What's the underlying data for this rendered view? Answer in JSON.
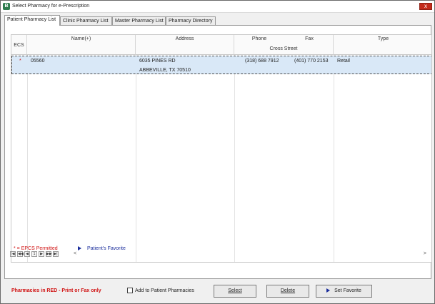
{
  "window": {
    "title": "Select Pharmacy for e-Prescription",
    "app_icon_letter": "B",
    "close_glyph": "x"
  },
  "tabs": [
    {
      "label": "Patient Pharmacy List"
    },
    {
      "label": "Clinic Pharmacy List"
    },
    {
      "label": "Master Pharmacy List"
    },
    {
      "label": "Pharmacy Directory"
    }
  ],
  "grid": {
    "columns": {
      "ecs": "ECS",
      "name": "Name(+)",
      "address": "Address",
      "phone": "Phone",
      "fax": "Fax",
      "cross_street": "Cross Street",
      "type": "Type"
    },
    "rows": [
      {
        "ecs": "*",
        "name": "05560",
        "address_line1": "6035 PINES RD",
        "address_line2": "ABBEVILLE, TX 70510",
        "phone": "(318) 688 7912",
        "fax": "(401) 770 2153",
        "type": "Retail"
      }
    ]
  },
  "navigator": {
    "first": "|◀",
    "prev_page": "◀◀",
    "prev": "◀",
    "page": "1",
    "next": "▶",
    "next_page": "▶▶",
    "last": "▶|",
    "scroll_left": "<",
    "scroll_right": ">"
  },
  "legend": {
    "epcs": "* = EPCS Permitted",
    "favorite": "Patient's Favorite"
  },
  "footer": {
    "note": "Pharmacies in RED - Print or Fax only",
    "add_checkbox_label": "Add to Patient Pharmacies",
    "select_button": "Select",
    "delete_button": "Delete",
    "favorite_button": "Set Favorite"
  },
  "colors": {
    "accent_red": "#d01010",
    "favorite_blue": "#1a2d9c",
    "row_highlight": "#d9e8f7"
  }
}
